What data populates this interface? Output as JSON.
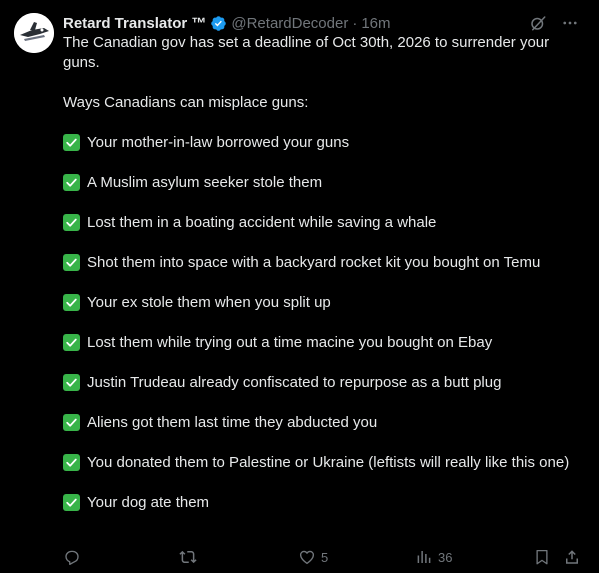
{
  "author": {
    "name": "Retard Translator ™",
    "handle": "@RetardDecoder",
    "separator": "·",
    "time": "16m",
    "verified_color": "#1d9bf0"
  },
  "tweet": {
    "intro": "The Canadian gov has set a deadline of Oct 30th, 2026 to surrender your guns.",
    "lead": "Ways Canadians can misplace guns:",
    "items": [
      "Your mother-in-law borrowed your guns",
      "A Muslim asylum seeker stole them",
      "Lost them in a boating accident while saving a whale",
      "Shot them into space with a backyard rocket kit you bought on Temu",
      "Your ex stole them when you split up",
      "Lost them while trying out a time macine you bought on Ebay",
      "Justin Trudeau already confiscated to repurpose as a butt plug",
      "Aliens got them last time they abducted you",
      "You donated them to Palestine or Ukraine (leftists will really like this one)",
      "Your dog ate them"
    ],
    "check_color": "#38b449"
  },
  "actions": {
    "reply_count": "",
    "retweet_count": "",
    "like_count": "5",
    "views_count": "36",
    "icon_color": "#71767b"
  },
  "icons": {
    "header": [
      "grok-icon",
      "more-icon"
    ],
    "actions": [
      "reply-icon",
      "retweet-icon",
      "like-icon",
      "views-icon",
      "bookmark-icon",
      "share-icon"
    ]
  }
}
